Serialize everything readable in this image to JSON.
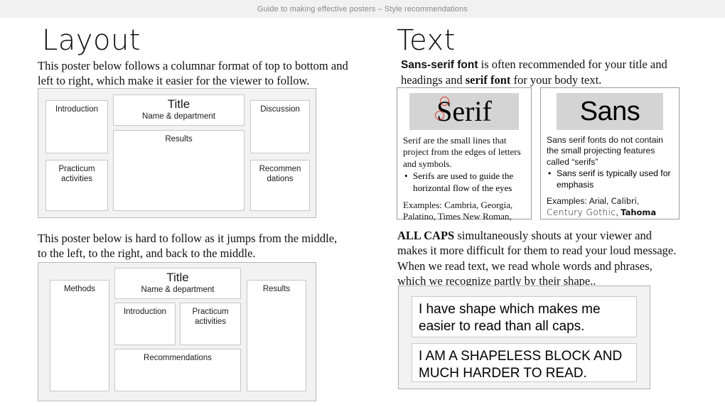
{
  "header": {
    "title": "Guide to making effective posters – Style recommendations"
  },
  "left_column": {
    "heading": "Layout",
    "paragraph_1": "This poster below follows a columnar format of top to bottom and left to right, which make it easier for the viewer to follow.",
    "paragraph_2": "This poster below is hard to follow as it jumps from the middle, to the left, to the right, and back to the middle.",
    "poster_good": {
      "boxes": [
        {
          "label": "Introduction"
        },
        {
          "label": "Practicum activities"
        },
        {
          "title": "Title",
          "subtitle": "Name & department"
        },
        {
          "label": "Results"
        },
        {
          "label": "Discussion"
        },
        {
          "label": "Recommen dations"
        }
      ]
    },
    "poster_bad": {
      "boxes": [
        {
          "label": "Methods"
        },
        {
          "title": "Title",
          "subtitle": "Name & department"
        },
        {
          "label": "Introduction"
        },
        {
          "label": "Practicum activities"
        },
        {
          "label": "Recommendations"
        },
        {
          "label": "Results"
        }
      ]
    }
  },
  "right_column": {
    "heading": "Text",
    "intro_bold_sans": "Sans-serif font",
    "intro_part1": " is often recommended for your title and headings and ",
    "intro_bold_serif": "serif font",
    "intro_part2": " for your body text.",
    "serif_card": {
      "sample": "Serif",
      "body": "Serif are the small lines that project from the edges of letters and symbols.",
      "bullets": [
        "Serifs are used to guide the horizontal flow of the eyes"
      ],
      "examples_label": "Examples: ",
      "examples": "Cambria, Georgia, Palatino, Times New Roman,"
    },
    "sans_card": {
      "sample": "Sans",
      "body": "Sans serif fonts do not contain the small projecting features called “serifs”",
      "bullets": [
        "Sans serif is typically used for emphasis"
      ],
      "examples_label": "Examples: ",
      "example_arial": "Arial",
      "example_calibri": "Calibri",
      "example_century": "Century Gothic",
      "example_tahoma": "Tahoma"
    },
    "allcaps_bold": "ALL CAPS",
    "allcaps_rest": " simultaneously shouts at your viewer and makes it more difficult for them to read your loud message. When we read text, we read whole words and phrases, which we recognize partly by their shape..",
    "shape_demo": {
      "good": "I have shape which makes me easier to read than all caps.",
      "bad": "I AM A SHAPELESS BLOCK AND MUCH HARDER TO READ."
    }
  },
  "colors": {
    "header_bg": "#f1f1f1",
    "header_text": "#8a8a8a",
    "poster_bg": "#f2f2f2",
    "poster_border": "#b8b8b8",
    "box_border": "#c7c7c7",
    "sample_bg": "#d4d4d4",
    "serif_mark": "#e03a2f"
  }
}
